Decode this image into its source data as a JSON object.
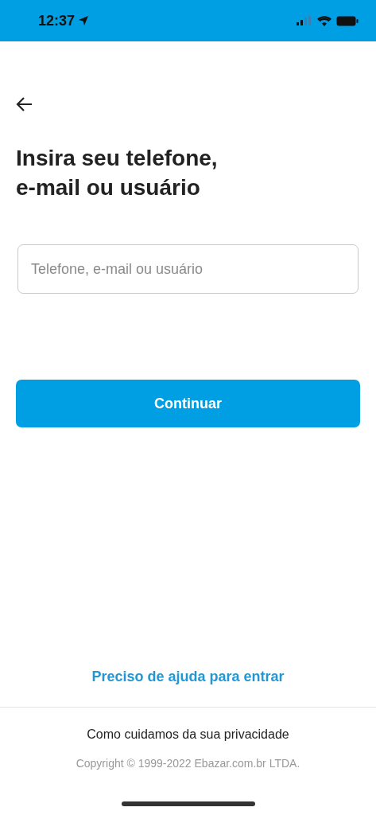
{
  "status_bar": {
    "time": "12:37"
  },
  "title": "Insira seu telefone,\ne-mail ou usuário",
  "login_field": {
    "placeholder": "Telefone, e-mail ou usuário"
  },
  "continue_button": {
    "label": "Continuar"
  },
  "help_link": "Preciso de ajuda para entrar",
  "privacy_link": "Como cuidamos da sua privacidade",
  "copyright": "Copyright © 1999-2022 Ebazar.com.br LTDA."
}
